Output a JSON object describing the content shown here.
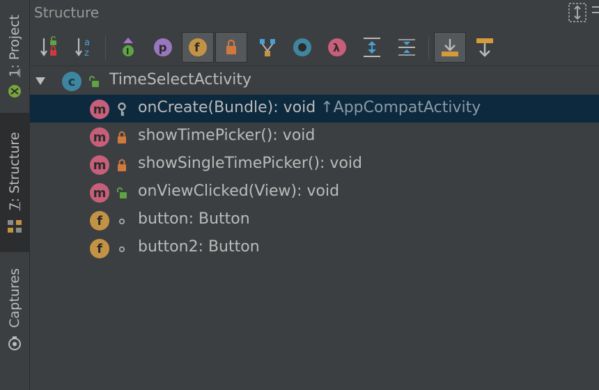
{
  "stripe": {
    "project_num": "1",
    "project_text": ": Project",
    "structure_num": "7",
    "structure_text": ": Structure",
    "captures": "Captures"
  },
  "panel": {
    "title": "Structure"
  },
  "toolbar": {
    "buttons": [
      {
        "icon": "sort-by-visibility-icon",
        "pressed": false
      },
      {
        "icon": "sort-alphabetically-icon",
        "pressed": false
      },
      {
        "icon": "show-inherited-icon",
        "pressed": false
      },
      {
        "icon": "show-properties-icon",
        "pressed": false
      },
      {
        "icon": "show-fields-icon",
        "pressed": true
      },
      {
        "icon": "show-non-public-icon",
        "pressed": true
      },
      {
        "icon": "show-anonymous-classes-icon",
        "pressed": false
      },
      {
        "icon": "show-interfaces-icon",
        "pressed": false
      },
      {
        "icon": "show-lambdas-icon",
        "pressed": false
      },
      {
        "icon": "expand-all-icon",
        "pressed": false
      },
      {
        "icon": "collapse-all-icon",
        "pressed": false
      },
      {
        "icon": "autoscroll-to-source-icon",
        "pressed": true
      },
      {
        "icon": "autoscroll-from-source-icon",
        "pressed": false
      }
    ]
  },
  "tree": {
    "root": {
      "badge": "c",
      "name": "TimeSelectActivity"
    },
    "items": [
      {
        "badge": "m",
        "visibility": "protected",
        "name": "onCreate(Bundle)",
        "type": ": void",
        "super": "↑AppCompatActivity",
        "selected": true
      },
      {
        "badge": "m",
        "visibility": "private",
        "name": "showTimePicker()",
        "type": ": void",
        "super": "",
        "selected": false
      },
      {
        "badge": "m",
        "visibility": "private",
        "name": "showSingleTimePicker()",
        "type": ": void",
        "super": "",
        "selected": false
      },
      {
        "badge": "m",
        "visibility": "public",
        "name": "onViewClicked(View)",
        "type": ": void",
        "super": "",
        "selected": false
      },
      {
        "badge": "f",
        "visibility": "package",
        "name": "button",
        "type": ": Button",
        "super": "",
        "selected": false
      },
      {
        "badge": "f",
        "visibility": "package",
        "name": "button2",
        "type": ": Button",
        "super": "",
        "selected": false
      }
    ]
  },
  "colors": {
    "background": "#3c3f41",
    "selection": "#0d293e",
    "method_badge": "#c75f7a",
    "field_badge": "#c39345",
    "class_badge": "#3e86a0",
    "public_lock": "#5fa343",
    "private_lock": "#d0793f"
  }
}
